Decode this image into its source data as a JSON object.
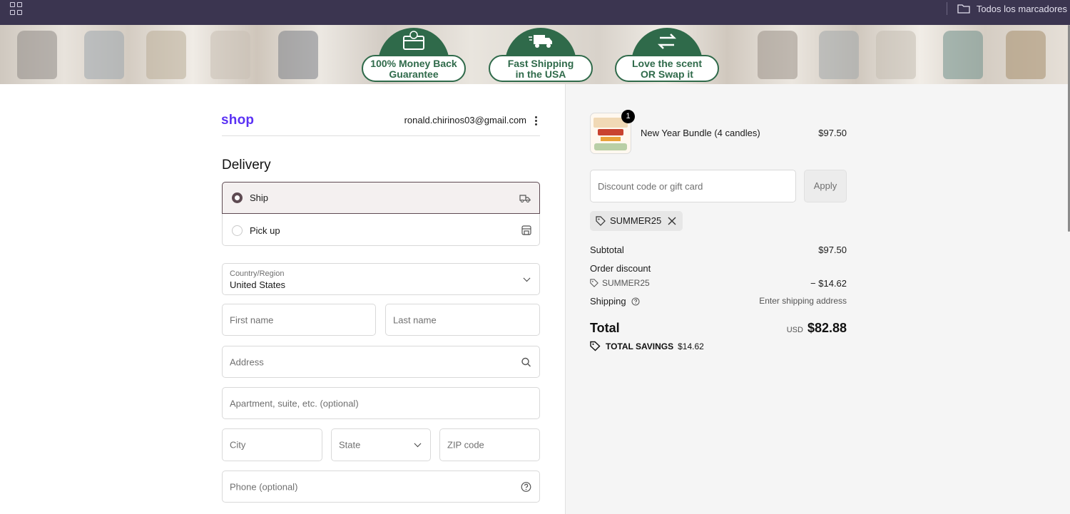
{
  "browser": {
    "bookmarks_folder": "Todos los marcadores"
  },
  "banner": {
    "badges": [
      {
        "line1": "100% Money Back",
        "line2": "Guarantee"
      },
      {
        "line1": "Fast Shipping",
        "line2": "in the USA"
      },
      {
        "line1": "Love the scent",
        "line2": "OR Swap it"
      }
    ]
  },
  "checkout": {
    "logo": "shop",
    "email": "ronald.chirinos03@gmail.com",
    "delivery_title": "Delivery",
    "delivery_options": [
      {
        "label": "Ship",
        "selected": true,
        "icon": "truck-icon"
      },
      {
        "label": "Pick up",
        "selected": false,
        "icon": "store-icon"
      }
    ],
    "country_label": "Country/Region",
    "country_value": "United States",
    "first_name_placeholder": "First name",
    "last_name_placeholder": "Last name",
    "address_placeholder": "Address",
    "apartment_placeholder": "Apartment, suite, etc. (optional)",
    "city_placeholder": "City",
    "state_placeholder": "State",
    "zip_placeholder": "ZIP code",
    "phone_placeholder": "Phone (optional)"
  },
  "summary": {
    "item": {
      "quantity": "1",
      "name": "New Year Bundle (4 candles)",
      "price": "$97.50"
    },
    "discount_placeholder": "Discount code or gift card",
    "apply_label": "Apply",
    "applied_code": "SUMMER25",
    "subtotal_label": "Subtotal",
    "subtotal_value": "$97.50",
    "order_discount_label": "Order discount",
    "discount_code": "SUMMER25",
    "discount_value": "− $14.62",
    "shipping_label": "Shipping",
    "shipping_value": "Enter shipping address",
    "total_label": "Total",
    "currency": "USD",
    "total_value": "$82.88",
    "savings_label": "TOTAL SAVINGS",
    "savings_value": "$14.62"
  },
  "colors": {
    "brand": "#5a31f4",
    "accent": "#5e4a52",
    "banner_green": "#2f6a4a"
  }
}
